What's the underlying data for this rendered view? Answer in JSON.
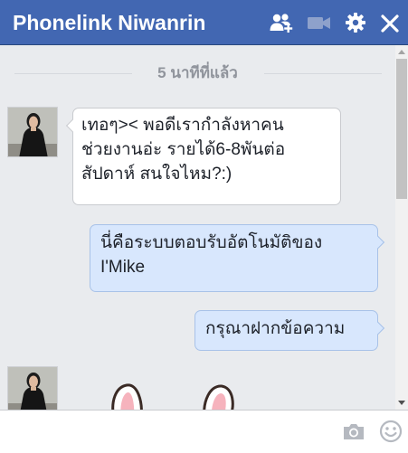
{
  "window": {
    "title": "Phonelink Niwanrin",
    "header_icons": [
      "add-friend-icon",
      "video-call-icon",
      "gear-icon",
      "close-icon"
    ]
  },
  "conversation": {
    "timestamp": "5 นาทีที่แล้ว",
    "messages": [
      {
        "direction": "incoming",
        "lines": [
          "เทอๆ>< พอดีเรากำลังหาคน",
          "ช่วยงานอ่ะ รายได้6-8พันต่อ",
          "สัปดาห์ สนใจไหม?:)"
        ]
      },
      {
        "direction": "outgoing",
        "lines": [
          "นี่คือระบบตอบรับอัตโนมัติของ",
          "I'Mike"
        ]
      },
      {
        "direction": "outgoing",
        "lines": [
          "กรุณาฝากข้อความ"
        ]
      },
      {
        "direction": "incoming",
        "type": "sticker",
        "sticker": "bunny-sticker"
      }
    ]
  },
  "composer": {
    "value": "",
    "icons": [
      "camera-icon",
      "emoji-icon"
    ]
  },
  "colors": {
    "header": "#4267b2",
    "background": "#e9ebee",
    "outgoing_bubble": "#d8e7fd",
    "incoming_bubble": "#ffffff"
  }
}
